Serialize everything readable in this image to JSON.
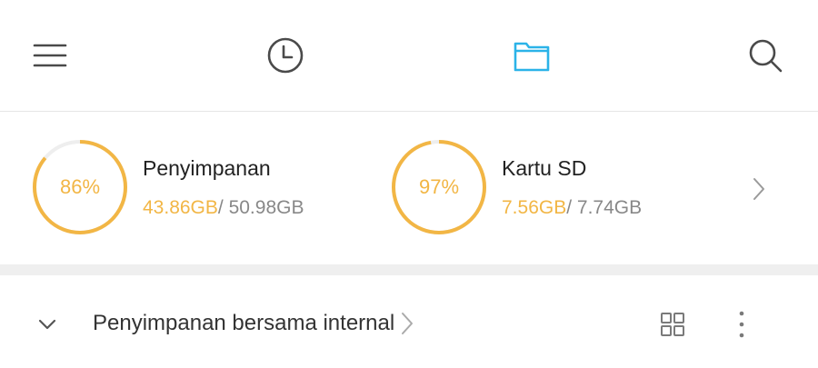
{
  "toolbar": {
    "icons": [
      "menu-icon",
      "clock-icon",
      "folder-icon",
      "search-icon"
    ],
    "active_tab": "folder-icon",
    "active_color": "#2bb3e8",
    "inactive_color": "#4a4a4a"
  },
  "storage": {
    "accent_color": "#f2b645",
    "items": [
      {
        "percent_label": "86%",
        "percent_value": 0.86,
        "name": "Penyimpanan",
        "used": "43.86GB",
        "total": "/ 50.98GB"
      },
      {
        "percent_label": "97%",
        "percent_value": 0.97,
        "name": "Kartu SD",
        "used": "7.56GB",
        "total": "/ 7.74GB"
      }
    ],
    "chevron_icon": "chevron-right-icon"
  },
  "location": {
    "expand_icon": "chevron-down-icon",
    "label": "Penyimpanan bersama internal",
    "path_chevron_icon": "chevron-right-icon",
    "view_icon": "grid-view-icon",
    "more_icon": "more-vertical-icon"
  }
}
